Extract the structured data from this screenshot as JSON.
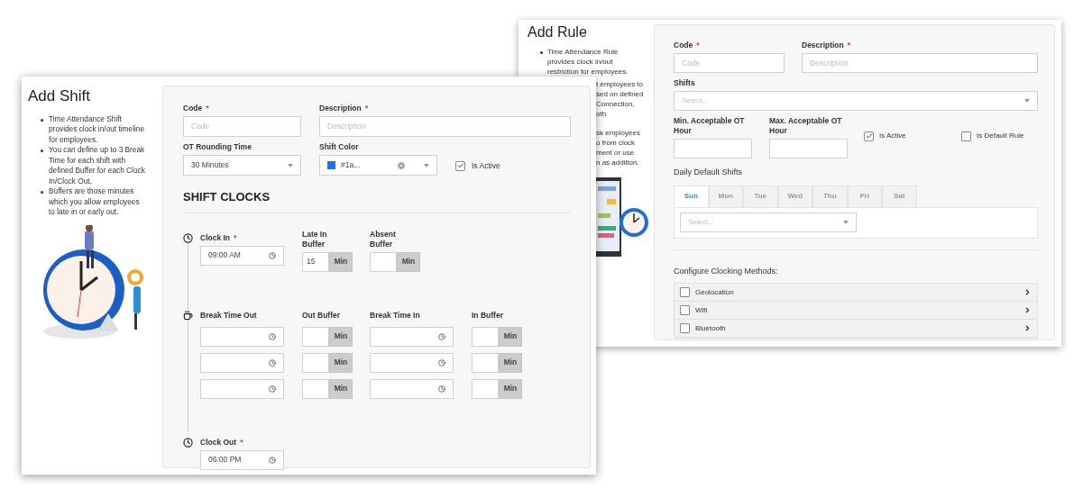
{
  "add_rule_window": {
    "title": "Add Rule",
    "bullets": [
      {
        "text": "Time Attendance Rule provides clock in/out restriction for employees."
      }
    ],
    "cut_line_groups": [
      [
        "t employees to",
        "sed on defined",
        "Connection,",
        "oth"
      ],
      [
        "sk employees",
        "o from clock",
        "ment or use",
        "n as addition."
      ]
    ],
    "code": {
      "label": "Code",
      "required_mark": "*",
      "placeholder": "Code"
    },
    "description": {
      "label": "Description",
      "required_mark": "*",
      "placeholder": "Description"
    },
    "shifts": {
      "label": "Shifts",
      "placeholder": "Select..."
    },
    "min_ot": {
      "label": "Min. Acceptable OT Hour"
    },
    "max_ot": {
      "label": "Max. Acceptable OT Hour"
    },
    "checkboxes": [
      {
        "label": "Is Active",
        "checked": true
      },
      {
        "label": "Is Default Rule",
        "checked": false
      }
    ],
    "daily_default_shifts": {
      "label": "Daily Default Shifts",
      "tabs": [
        {
          "label": "Sun",
          "selected": true
        },
        {
          "label": "Mon",
          "selected": false
        },
        {
          "label": "Tue",
          "selected": false
        },
        {
          "label": "Wed",
          "selected": false
        },
        {
          "label": "Thu",
          "selected": false
        },
        {
          "label": "Fri",
          "selected": false
        },
        {
          "label": "Sat",
          "selected": false
        }
      ],
      "placeholder": "Select..."
    },
    "clocking_methods": {
      "label": "Configure Clocking Methods:",
      "items": [
        {
          "label": "Geolocation",
          "checked": false
        },
        {
          "label": "Wifi",
          "checked": false
        },
        {
          "label": "Bluetooth",
          "checked": false
        }
      ]
    }
  },
  "add_shift_window": {
    "title": "Add Shift",
    "bullets": [
      {
        "text": "Time Attendance Shift provides clock in/out timeline for employees."
      },
      {
        "text": "You can define up to 3 Break Time for each shift with defined Buffer for each Clock In/Clock Out."
      },
      {
        "text": "Buffers are those minutes which you allow employees to late in or early out."
      }
    ],
    "code": {
      "label": "Code",
      "required_mark": "*",
      "placeholder": "Code"
    },
    "description": {
      "label": "Description",
      "required_mark": "*",
      "placeholder": "Description"
    },
    "ot_rounding_time": {
      "label": "OT Rounding Time",
      "value": "30 Minutes"
    },
    "shift_color": {
      "label": "Shift Color",
      "value": "#1a...",
      "color": "#1a73e8"
    },
    "is_active": {
      "label": "Is Active",
      "checked": true
    },
    "section_title": "SHIFT CLOCKS",
    "clock_in": {
      "label": "Clock In",
      "required_mark": "*",
      "value": "09:00 AM"
    },
    "late_in_buffer": {
      "label": "Late In Buffer",
      "value": "15",
      "unit": "Min"
    },
    "absent_buffer": {
      "label": "Absent Buffer",
      "unit": "Min"
    },
    "break_columns": [
      "Break Time Out",
      "Out Buffer",
      "Break Time In",
      "In Buffer"
    ],
    "break_rows": [
      {
        "out_unit": "Min",
        "in_unit": "Min"
      },
      {
        "out_unit": "Min",
        "in_unit": "Min"
      },
      {
        "out_unit": "Min",
        "in_unit": "Min"
      }
    ],
    "clock_out": {
      "label": "Clock Out",
      "required_mark": "*",
      "value": "06:00 PM"
    }
  }
}
